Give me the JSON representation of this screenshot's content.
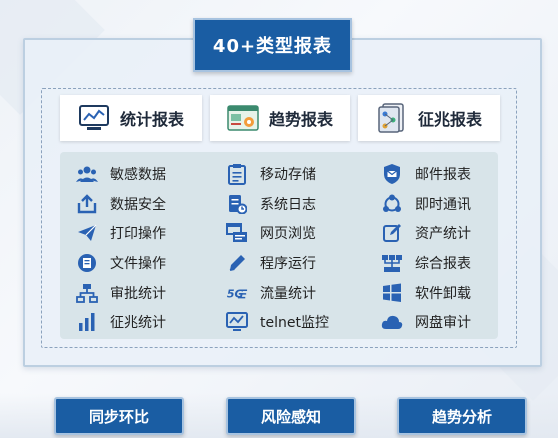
{
  "title": "40+类型报表",
  "categories": [
    {
      "label": "统计报表",
      "icon": "chart-screen-icon"
    },
    {
      "label": "趋势报表",
      "icon": "trend-window-icon"
    },
    {
      "label": "征兆报表",
      "icon": "document-flow-icon"
    }
  ],
  "columns": [
    [
      {
        "label": "敏感数据",
        "icon": "users-icon"
      },
      {
        "label": "数据安全",
        "icon": "upload-icon"
      },
      {
        "label": "打印操作",
        "icon": "send-icon"
      },
      {
        "label": "文件操作",
        "icon": "file-icon"
      },
      {
        "label": "审批统计",
        "icon": "org-chart-icon"
      },
      {
        "label": "征兆统计",
        "icon": "bar-chart-icon"
      }
    ],
    [
      {
        "label": "移动存储",
        "icon": "clipboard-icon"
      },
      {
        "label": "系统日志",
        "icon": "log-icon"
      },
      {
        "label": "网页浏览",
        "icon": "browser-icon"
      },
      {
        "label": "程序运行",
        "icon": "pencil-icon"
      },
      {
        "label": "流量统计",
        "icon": "speed-5g-icon"
      },
      {
        "label": "telnet监控",
        "icon": "monitor-icon"
      }
    ],
    [
      {
        "label": "邮件报表",
        "icon": "shield-mail-icon"
      },
      {
        "label": "即时通讯",
        "icon": "share-icon"
      },
      {
        "label": "资产统计",
        "icon": "edit-icon"
      },
      {
        "label": "综合报表",
        "icon": "network-icon"
      },
      {
        "label": "软件卸载",
        "icon": "windows-icon"
      },
      {
        "label": "网盘审计",
        "icon": "cloud-icon"
      }
    ]
  ],
  "buttons": [
    "同步环比",
    "风险感知",
    "趋势分析"
  ],
  "colors": {
    "brand": "#1a5da3",
    "icon": "#2a62b3"
  }
}
